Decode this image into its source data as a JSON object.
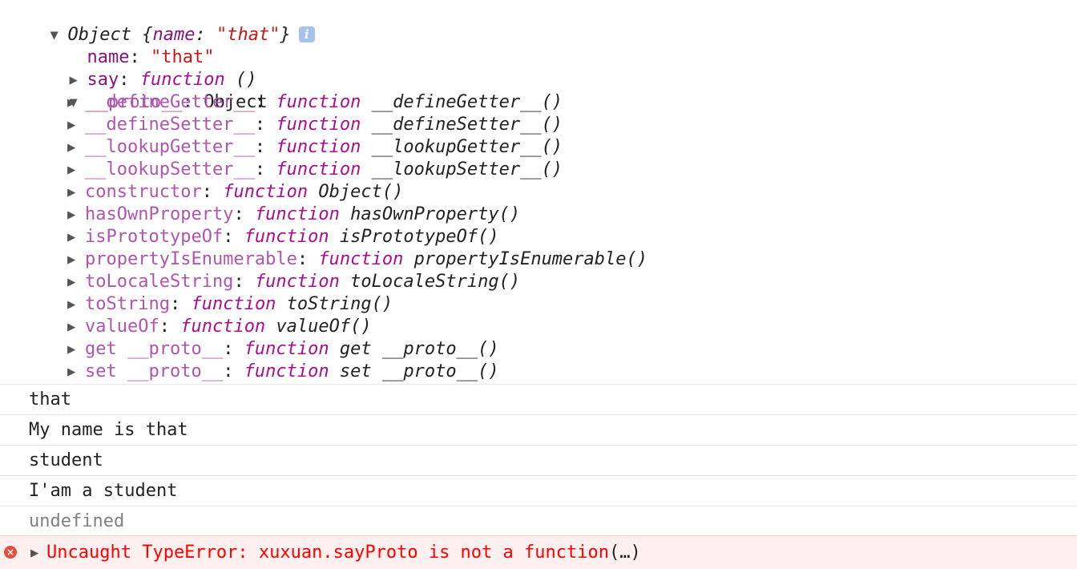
{
  "object_header": {
    "expand_glyph": "▼",
    "prefix": "Object {",
    "key": "name",
    "colon": ": ",
    "value": "\"that\"",
    "suffix": "}",
    "info_glyph": "i"
  },
  "own_properties": [
    {
      "key": "name",
      "sep": ": ",
      "value": "\"that\""
    },
    {
      "key": "say",
      "sep": ": ",
      "fn_keyword": "function",
      "fn_sig": "()"
    }
  ],
  "proto_node": {
    "key": "__proto__",
    "sep": ": ",
    "value": "Object"
  },
  "proto_entries": [
    {
      "key": "__defineGetter__",
      "sep": ": ",
      "fn_keyword": "function",
      "fn_sig": "__defineGetter__()"
    },
    {
      "key": "__defineSetter__",
      "sep": ": ",
      "fn_keyword": "function",
      "fn_sig": "__defineSetter__()"
    },
    {
      "key": "__lookupGetter__",
      "sep": ": ",
      "fn_keyword": "function",
      "fn_sig": "__lookupGetter__()"
    },
    {
      "key": "__lookupSetter__",
      "sep": ": ",
      "fn_keyword": "function",
      "fn_sig": "__lookupSetter__()"
    },
    {
      "key": "constructor",
      "sep": ": ",
      "fn_keyword": "function",
      "fn_sig": "Object()"
    },
    {
      "key": "hasOwnProperty",
      "sep": ": ",
      "fn_keyword": "function",
      "fn_sig": "hasOwnProperty()"
    },
    {
      "key": "isPrototypeOf",
      "sep": ": ",
      "fn_keyword": "function",
      "fn_sig": "isPrototypeOf()"
    },
    {
      "key": "propertyIsEnumerable",
      "sep": ": ",
      "fn_keyword": "function",
      "fn_sig": "propertyIsEnumerable()"
    },
    {
      "key": "toLocaleString",
      "sep": ": ",
      "fn_keyword": "function",
      "fn_sig": "toLocaleString()"
    },
    {
      "key": "toString",
      "sep": ": ",
      "fn_keyword": "function",
      "fn_sig": "toString()"
    },
    {
      "key": "valueOf",
      "sep": ": ",
      "fn_keyword": "function",
      "fn_sig": "valueOf()"
    },
    {
      "key": "get __proto__",
      "sep": ": ",
      "fn_keyword": "function",
      "fn_sig": "get __proto__()"
    },
    {
      "key": "set __proto__",
      "sep": ": ",
      "fn_keyword": "function",
      "fn_sig": "set __proto__()"
    }
  ],
  "logs": [
    "that",
    "My name is that",
    "student",
    "I'am a student",
    "undefined"
  ],
  "error": {
    "icon_glyph": "×",
    "expand_glyph": "▶",
    "message": "Uncaught TypeError: xuxuan.sayProto is not a function",
    "ellipsis": "(…)"
  },
  "glyphs": {
    "collapsed": "▶",
    "expanded": "▼"
  },
  "colors": {
    "own_key": "#881280",
    "proto_key": "#b054b0",
    "string": "#c41a16",
    "function_keyword": "#aa0d91",
    "error_text": "#ff0000",
    "error_bg": "#fff0f0",
    "info_badge": "#a6c2e8"
  }
}
